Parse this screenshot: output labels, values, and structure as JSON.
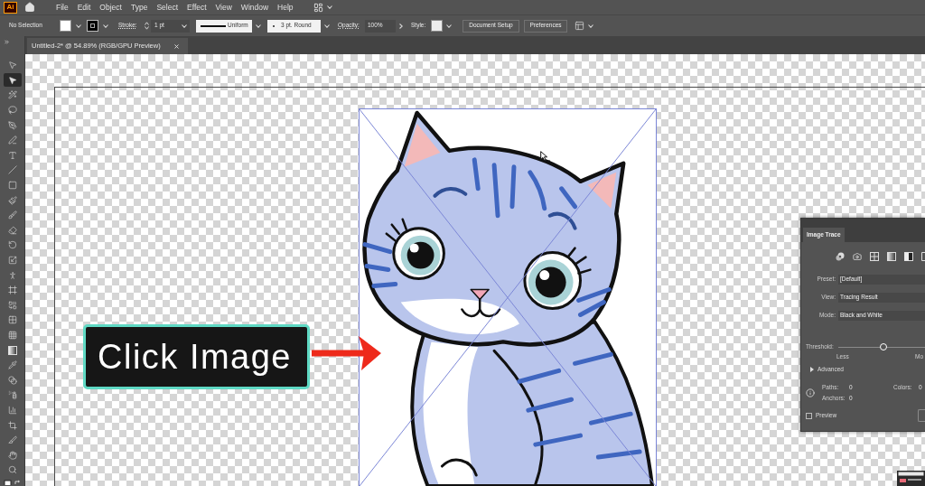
{
  "app": {
    "logo": "Ai"
  },
  "menu_bar": [
    "File",
    "Edit",
    "Object",
    "Type",
    "Select",
    "Effect",
    "View",
    "Window",
    "Help"
  ],
  "control_bar": {
    "selection": "No Selection",
    "stroke_label": "Stroke:",
    "stroke_weight": "1 pt",
    "stroke_profile": "Uniform",
    "brush": "3 pt. Round",
    "opacity_label": "Opacity:",
    "opacity": "100%",
    "style_label": "Style:",
    "buttons": [
      "Document Setup",
      "Preferences"
    ]
  },
  "document_tab": {
    "title": "Untitled-2* @ 54.89% (RGB/GPU Preview)"
  },
  "tools": [
    {
      "selected": false
    },
    {
      "selected": true
    },
    {
      "selected": false
    },
    {
      "selected": false
    },
    {
      "selected": false
    },
    {
      "selected": false
    },
    {
      "selected": false
    },
    {
      "selected": false
    },
    {
      "selected": false
    },
    {
      "selected": false
    },
    {
      "selected": false
    },
    {
      "selected": false
    },
    {
      "selected": false
    },
    {
      "selected": false
    },
    {
      "selected": false
    },
    {
      "selected": false
    },
    {
      "selected": false
    },
    {
      "selected": false
    },
    {
      "selected": false
    },
    {
      "selected": false
    },
    {
      "selected": false
    },
    {
      "selected": false
    },
    {
      "selected": false
    },
    {
      "selected": false
    },
    {
      "selected": false
    },
    {
      "selected": false
    },
    {
      "selected": false
    },
    {
      "selected": false
    }
  ],
  "callout": {
    "text": "Click Image"
  },
  "image_trace": {
    "title": "Image Trace",
    "fields": [
      {
        "label": "Preset:",
        "value": "[Default]"
      },
      {
        "label": "View:",
        "value": "Tracing Result"
      },
      {
        "label": "Mode:",
        "value": "Black and White"
      }
    ],
    "threshold": {
      "label": "Threshold:",
      "level": 0.52,
      "min_label": "Less",
      "max_label": "Mo"
    },
    "advanced": {
      "label": "Advanced",
      "expanded": false
    },
    "stats": [
      {
        "label": "Paths:",
        "value": "0"
      },
      {
        "label": "Colors:",
        "value": "0"
      },
      {
        "label": "Anchors:",
        "value": "0"
      }
    ],
    "preview": {
      "label": "Preview",
      "checked": false
    }
  }
}
